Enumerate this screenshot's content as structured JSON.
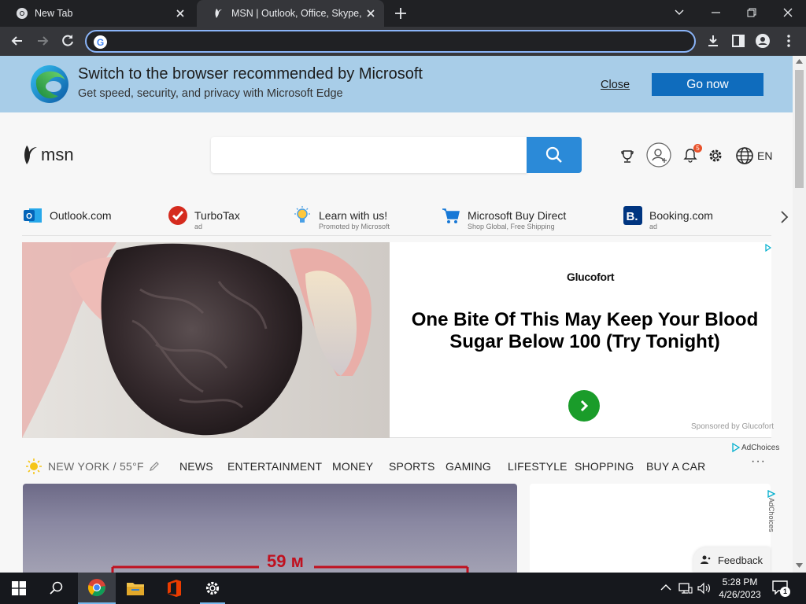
{
  "browser": {
    "tabs": [
      {
        "title": "New Tab",
        "active": false
      },
      {
        "title": "MSN | Outlook, Office, Skype, Bing",
        "active": true
      }
    ],
    "address": {
      "value": "",
      "placeholder": ""
    }
  },
  "edge_banner": {
    "title": "Switch to the browser recommended by Microsoft",
    "subtitle": "Get speed, security, and privacy with Microsoft Edge",
    "close_label": "Close",
    "go_label": "Go now"
  },
  "header": {
    "logo_text": "msn",
    "search_placeholder": "",
    "notification_count": "5",
    "language": "EN"
  },
  "quick_links": [
    {
      "label": "Outlook.com",
      "sub": ""
    },
    {
      "label": "TurboTax",
      "sub": "ad"
    },
    {
      "label": "Learn with us!",
      "sub": "Promoted by Microsoft"
    },
    {
      "label": "Microsoft Buy Direct",
      "sub": "Shop Global, Free Shipping"
    },
    {
      "label": "Booking.com",
      "sub": "ad"
    }
  ],
  "ad": {
    "brand": "Glucofort",
    "headline": "One Bite Of This May Keep Your Blood Sugar Below 100 (Try Tonight)",
    "sponsor": "Sponsored by Glucofort",
    "adchoices": "AdChoices"
  },
  "category_nav": {
    "weather": "NEW YORK / 55°F",
    "items": [
      "NEWS",
      "ENTERTAINMENT",
      "MONEY",
      "SPORTS",
      "GAMING",
      "LIFESTYLE",
      "SHOPPING",
      "BUY A CAR"
    ],
    "more": "···"
  },
  "hero": {
    "overlay_text": "59 м"
  },
  "side_card": {
    "adchoices": "AdChoices"
  },
  "feedback_label": "Feedback",
  "taskbar": {
    "time": "5:28 PM",
    "date": "4/26/2023",
    "notification_count": "1"
  },
  "colors": {
    "banner_bg": "#a8cde8",
    "go_button": "#0f6cbd",
    "search_button": "#2b8ad8",
    "ad_arrow": "#1a9c2a",
    "focus_ring": "#8ab4f8"
  }
}
